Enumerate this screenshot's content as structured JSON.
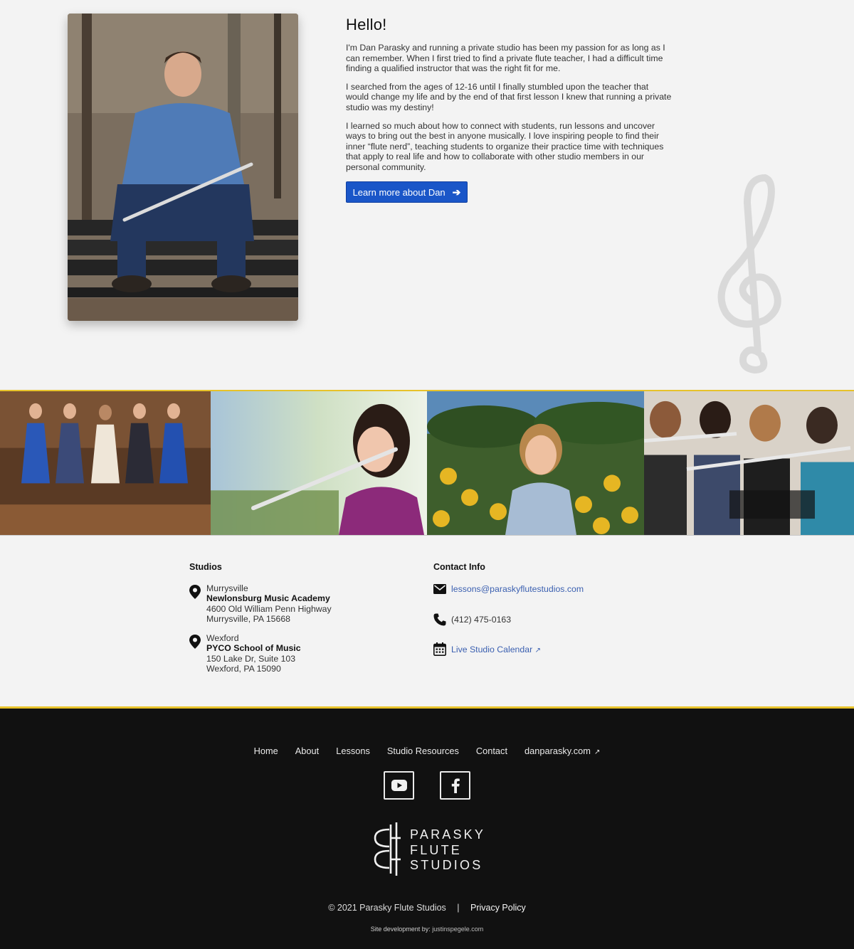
{
  "about": {
    "heading": "Hello!",
    "paragraphs": [
      "I'm Dan Parasky and running a private studio has been my passion for as long as I can remember. When I first tried to find a private flute teacher, I had a difficult time finding a qualified instructor that was the right fit for me.",
      "I searched from the ages of 12-16 until I finally stumbled upon the teacher that would change my life and by the end of that first lesson I knew that running a private studio was my destiny!",
      "I learned so much about how to connect with students, run lessons and uncover ways to bring out the best in anyone musically. I love inspiring people to find their inner “flute nerd”, teaching students to organize their practice time with techniques that apply to real life and how to collaborate with other studio members in our personal community."
    ],
    "cta_label": "Learn more about Dan",
    "cta_icon": "arrow-right-icon"
  },
  "studios": {
    "heading": "Studios",
    "locations": [
      {
        "city": "Murrysville",
        "name": "Newlonsburg Music Academy",
        "address": "4600 Old William Penn Highway",
        "city_state": "Murrysville, PA 15668"
      },
      {
        "city": "Wexford",
        "name": "PYCO School of Music",
        "address": "150 Lake Dr, Suite 103",
        "city_state": "Wexford, PA 15090"
      }
    ]
  },
  "contact": {
    "heading": "Contact Info",
    "email": "lessons@paraskyflutestudios.com",
    "phone": "(412) 475-0163",
    "calendar": "Live Studio Calendar"
  },
  "footer": {
    "nav": [
      "Home",
      "About",
      "Lessons",
      "Studio Resources",
      "Contact",
      "danparasky.com"
    ],
    "social": [
      "youtube-icon",
      "facebook-icon"
    ],
    "logo_lines": [
      "PARASKY",
      "FLUTE",
      "STUDIOS"
    ],
    "copyright": "© 2021 Parasky Flute Studios",
    "separator": "|",
    "privacy": "Privacy Policy",
    "dev_label": "Site development by:",
    "dev_link": "justinspegele.com"
  },
  "colors": {
    "accent": "#1a56c8",
    "gold": "#e7c22a",
    "footer_bg": "#111111",
    "link": "#3a5fb0"
  }
}
